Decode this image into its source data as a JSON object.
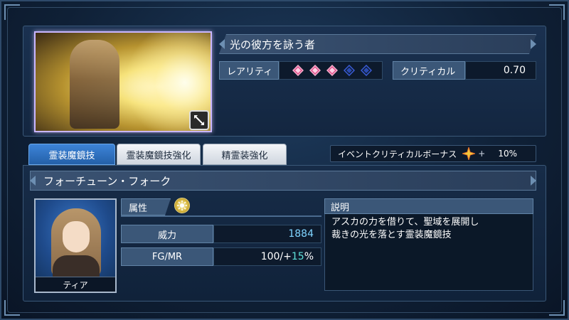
{
  "card": {
    "title": "光の彼方を詠う者",
    "rarity_label": "レアリティ",
    "rarity_gems": [
      {
        "color": "#e0508a",
        "filled": true
      },
      {
        "color": "#e0508a",
        "filled": true
      },
      {
        "color": "#e0508a",
        "filled": true
      },
      {
        "color": "#3a5cd8",
        "filled": false
      },
      {
        "color": "#3a5cd8",
        "filled": false
      }
    ],
    "critical_label": "クリティカル",
    "critical_value": "0.70",
    "expand_icon": "expand-arrows-icon"
  },
  "tabs": [
    {
      "label": "霊装魔鏡技",
      "active": true
    },
    {
      "label": "霊装魔鏡技強化",
      "active": false
    },
    {
      "label": "精霊装強化",
      "active": false
    }
  ],
  "event_bonus": {
    "label": "イベントクリティカルボーナス",
    "plus": "+",
    "value": "10%"
  },
  "skill": {
    "name": "フォーチューン・フォーク",
    "attribute_label": "属性",
    "attribute_icon": "light-element-icon",
    "power_label": "威力",
    "power_value": "1884",
    "fgmr_label": "FG/MR",
    "fgmr_base": "100/+",
    "fgmr_bonus": "15",
    "fgmr_unit": "%",
    "character_name": "ティア",
    "description_label": "説明",
    "description": "アスカの力を借りて、聖域を展開し\n裁きの光を落とす霊装魔鏡技"
  },
  "colors": {
    "accent_blue": "#2460a8",
    "value_cyan": "#7fd4ff",
    "bonus_cyan": "#5ee0d8"
  }
}
